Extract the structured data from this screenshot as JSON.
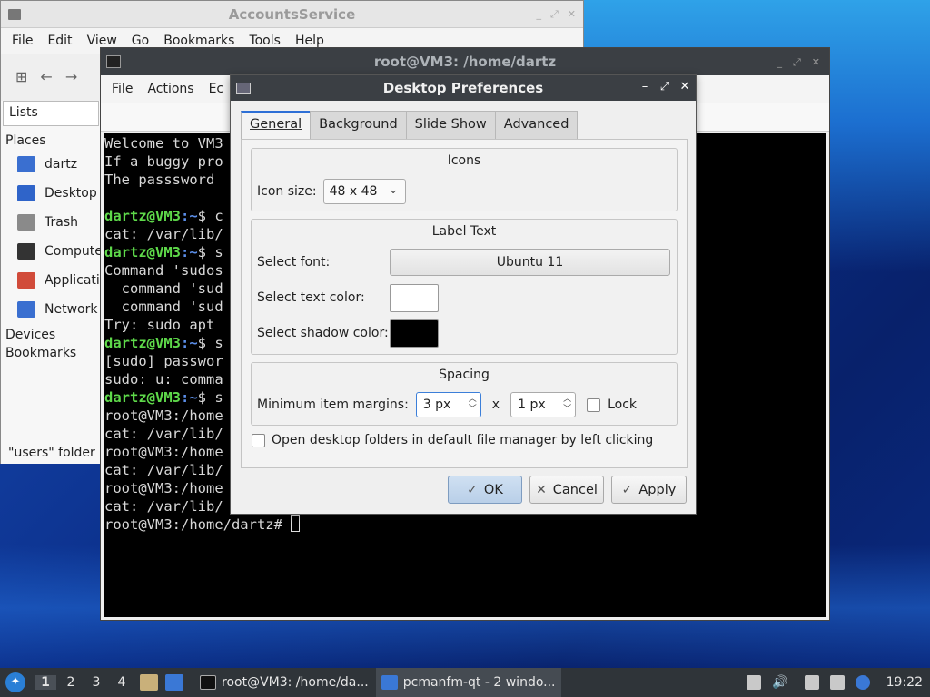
{
  "desktop": {
    "colors": {
      "accent": "#2d6fd6",
      "terminal_bg": "#000000",
      "prompt_user": "#5ed94a",
      "prompt_path": "#5b8ee8"
    }
  },
  "file_manager": {
    "title": "AccountsService",
    "menu": [
      "File",
      "Edit",
      "View",
      "Go",
      "Bookmarks",
      "Tools",
      "Help"
    ],
    "sidebar": {
      "mode": "Lists",
      "places_label": "Places",
      "places": [
        {
          "label": "dartz",
          "icon": "home-folder-icon",
          "color": "#3a6fd0"
        },
        {
          "label": "Desktop",
          "icon": "desktop-icon",
          "color": "#2f64c9"
        },
        {
          "label": "Trash",
          "icon": "trash-icon",
          "color": "#8a8a8a"
        },
        {
          "label": "Compute",
          "icon": "computer-icon",
          "color": "#333333"
        },
        {
          "label": "Applicatio",
          "icon": "applications-icon",
          "color": "#d14b3a"
        },
        {
          "label": "Network",
          "icon": "network-icon",
          "color": "#3a6fd0"
        }
      ],
      "devices_label": "Devices",
      "bookmarks_label": "Bookmarks"
    },
    "status": "\"users\" folder"
  },
  "terminal": {
    "title": "root@VM3: /home/dartz",
    "menu": [
      "File",
      "Actions",
      "Ec"
    ],
    "lines": [
      {
        "text": "Welcome to VM3"
      },
      {
        "text": "If a buggy pro"
      },
      {
        "text": "The passsword"
      },
      {
        "text": ""
      },
      {
        "user": "dartz@VM3",
        "path": ":~",
        "rest": "$ c"
      },
      {
        "text": "cat: /var/lib/"
      },
      {
        "user": "dartz@VM3",
        "path": ":~",
        "rest": "$ s"
      },
      {
        "text": "Command 'sudos"
      },
      {
        "text": "  command 'sud"
      },
      {
        "text": "  command 'sud"
      },
      {
        "text": "Try: sudo apt"
      },
      {
        "user": "dartz@VM3",
        "path": ":~",
        "rest": "$ s"
      },
      {
        "text": "[sudo] passwor"
      },
      {
        "text": "sudo: u: comma"
      },
      {
        "user": "dartz@VM3",
        "path": ":~",
        "rest": "$ s"
      },
      {
        "text": "root@VM3:/home"
      },
      {
        "text": "cat: /var/lib/                                             ory"
      },
      {
        "text": "root@VM3:/home"
      },
      {
        "text": "cat: /var/lib/                                             ory"
      },
      {
        "text": "root@VM3:/home"
      },
      {
        "text": "cat: /var/lib/"
      },
      {
        "text": "root@VM3:/home/dartz# ",
        "cursor": true
      }
    ]
  },
  "dialog": {
    "title": "Desktop Preferences",
    "tabs": [
      "General",
      "Background",
      "Slide Show",
      "Advanced"
    ],
    "icons_group": {
      "title": "Icons",
      "icon_size_label": "Icon size:",
      "icon_size_value": "48 x 48"
    },
    "label_group": {
      "title": "Label Text",
      "font_label": "Select font:",
      "font_value": "Ubuntu 11",
      "text_color_label": "Select text color:",
      "text_color": "#ffffff",
      "shadow_color_label": "Select shadow color:",
      "shadow_color": "#000000"
    },
    "spacing_group": {
      "title": "Spacing",
      "margins_label": "Minimum item margins:",
      "margin_x": "3 px",
      "separator": "x",
      "margin_y": "1 px",
      "lock_label": "Lock"
    },
    "open_folders_label": "Open desktop folders in default file manager by left clicking",
    "buttons": {
      "ok": "OK",
      "cancel": "Cancel",
      "apply": "Apply"
    }
  },
  "taskbar": {
    "desktops": [
      "1",
      "2",
      "3",
      "4"
    ],
    "tasks": [
      {
        "label": "root@VM3: /home/da...",
        "icon": "terminal-icon"
      },
      {
        "label": "pcmanfm-qt - 2 windo...",
        "icon": "folder-icon"
      }
    ],
    "clock": "19:22"
  }
}
